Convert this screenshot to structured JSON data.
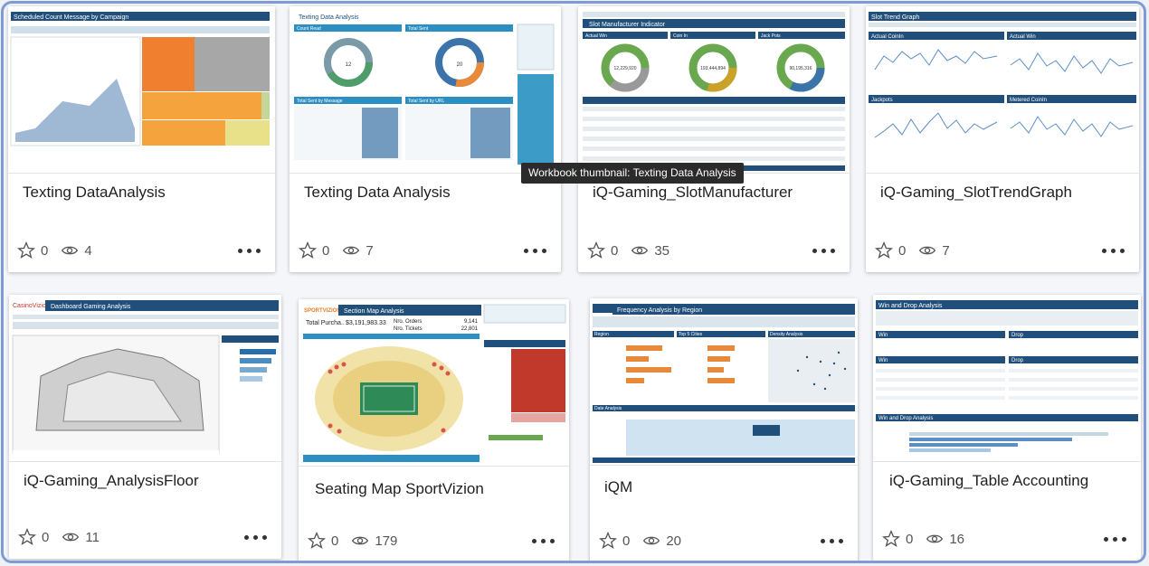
{
  "tooltip": "Workbook thumbnail: Texting Data Analysis",
  "colors": {
    "accent": "#1f4f7a",
    "frame": "#7f9bd6"
  },
  "icons": {
    "favorite": "star-icon",
    "views": "eye-icon",
    "more": "more-options-icon"
  },
  "cards": [
    {
      "title": "Texting DataAnalysis",
      "favorites": "0",
      "views": "4",
      "thumb": {
        "header": "Scheduled Count Message by Campaign"
      }
    },
    {
      "title": "Texting Data Analysis",
      "favorites": "0",
      "views": "7",
      "thumb": {
        "header": "Texting Data Analysis",
        "panels": [
          "Count Read",
          "Total Sent"
        ],
        "donut1": "Count Read",
        "donut1_value": "12",
        "donut2": "Total Sent",
        "donut2_value": "20",
        "table1": "Total Sent by Message",
        "table2": "Total Sent by URL"
      }
    },
    {
      "title": "iQ-Gaming_SlotManufacturer",
      "favorites": "0",
      "views": "35",
      "thumb": {
        "header": "Slot Manufacturer Indicator",
        "panels": [
          "Actual Win",
          "Coin In",
          "Jack Pots"
        ],
        "values": [
          "12,229,920",
          "193,444,894",
          "90,195,316"
        ]
      }
    },
    {
      "title": "iQ-Gaming_SlotTrendGraph",
      "favorites": "0",
      "views": "7",
      "thumb": {
        "header": "Slot Trend Graph",
        "panels": [
          "Actual CoinIn",
          "Actual Win",
          "Jackpots",
          "Metered CoinIn"
        ]
      }
    },
    {
      "title": "iQ-Gaming_AnalysisFloor",
      "favorites": "0",
      "views": "11",
      "thumb": {
        "header": "Dashboard Gaming Analysis",
        "brand": "CasinoVizion"
      }
    },
    {
      "title": "Seating Map SportVizion",
      "favorites": "0",
      "views": "179",
      "thumb": {
        "header": "Section Map Analysis",
        "brand": "SPORTVIZION",
        "stat_label": "Total Purcha..",
        "stat_value": "$3,191,983.33",
        "orders_label": "Nro. Orders",
        "orders_value": "9,141",
        "tickets_label": "Nro. Tickets",
        "tickets_value": "22,801"
      }
    },
    {
      "title": "iQM",
      "favorites": "0",
      "views": "20",
      "thumb": {
        "header": "Frequency Analysis by Region",
        "sections": [
          "Region",
          "Top 5 Cities",
          "Density Analysis",
          "Date Analysis"
        ]
      }
    },
    {
      "title": "iQ-Gaming_Table Accounting",
      "favorites": "0",
      "views": "16",
      "thumb": {
        "header": "Win and Drop Analysis",
        "panels": [
          "Win",
          "Drop"
        ],
        "section2": "Win and Drop Analysis"
      }
    }
  ]
}
